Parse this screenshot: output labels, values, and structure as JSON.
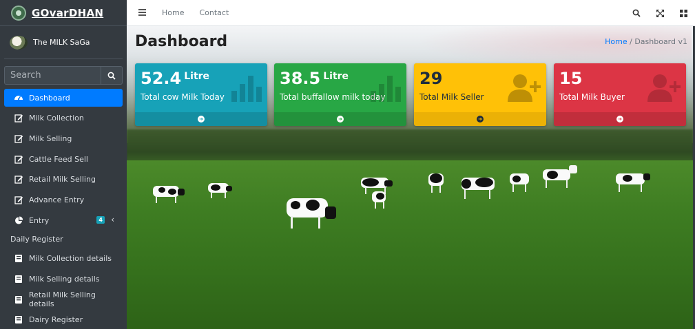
{
  "brand": {
    "name": "GOvarDHAN"
  },
  "user": {
    "name": "The MILK SaGa"
  },
  "search": {
    "placeholder": "Search"
  },
  "sidebar": {
    "items": [
      {
        "label": "Dashboard",
        "icon": "dashboard-icon",
        "active": true
      },
      {
        "label": "Milk Collection",
        "icon": "edit-icon"
      },
      {
        "label": "Milk Selling",
        "icon": "edit-icon"
      },
      {
        "label": "Cattle Feed Sell",
        "icon": "edit-icon"
      },
      {
        "label": "Retail Milk Selling",
        "icon": "edit-icon"
      },
      {
        "label": "Advance Entry",
        "icon": "edit-icon"
      },
      {
        "label": "Entry",
        "icon": "pie-chart-icon",
        "badge": "4"
      }
    ],
    "section_header": "Daily Register",
    "register_items": [
      {
        "label": "Milk Collection details",
        "icon": "book-icon"
      },
      {
        "label": "Milk Selling details",
        "icon": "book-icon"
      },
      {
        "label": "Retail Milk Selling details",
        "icon": "book-icon"
      },
      {
        "label": "Dairy Register",
        "icon": "book-icon"
      }
    ]
  },
  "navbar": {
    "links": [
      "Home",
      "Contact"
    ],
    "right_icons": [
      "search-icon",
      "fullscreen-icon",
      "apps-grid-icon"
    ]
  },
  "page": {
    "title": "Dashboard",
    "breadcrumb": {
      "home": "Home",
      "separator": "/",
      "current": "Dashboard v1"
    }
  },
  "stats": [
    {
      "value": "52.4",
      "unit": "Litre",
      "label": "Total cow Milk Today",
      "color": "#17a2b8",
      "icon": "bar-chart-icon"
    },
    {
      "value": "38.5",
      "unit": "Litre",
      "label": "Total buffallow milk today",
      "color": "#28a745",
      "icon": "bar-chart-icon"
    },
    {
      "value": "29",
      "unit": "",
      "label": "Total Milk Seller",
      "color": "#ffc107",
      "icon": "user-plus-icon"
    },
    {
      "value": "15",
      "unit": "",
      "label": "Total Milk Buyer",
      "color": "#dc3545",
      "icon": "user-plus-icon"
    }
  ],
  "colors": {
    "sidebar_bg": "#343a40",
    "active": "#007bff",
    "badge": "#17a2b8"
  }
}
